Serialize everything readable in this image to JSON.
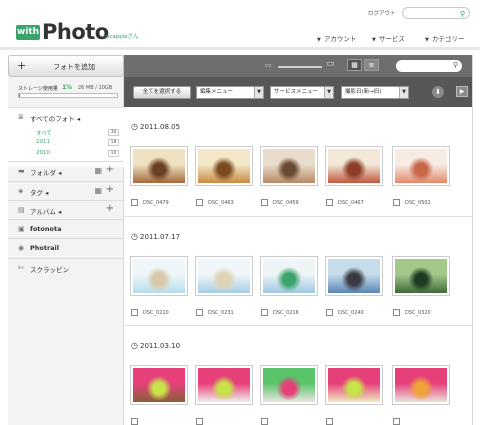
{
  "header": {
    "login": "ログアウト",
    "logo_badge": "with",
    "logo_word": "Photo",
    "greeting": "cocappleさん",
    "nav": [
      "アカウント",
      "サービス",
      "カテゴリー"
    ],
    "nav_arrow": "▼",
    "search_icon": "⚲"
  },
  "sidebar": {
    "add_photo": {
      "plus": "+",
      "label": "フォトを追加"
    },
    "storage": {
      "label": "ストレージ使用量",
      "percent": "1%",
      "value": "26 MB / 10GB",
      "fill_fraction": 0.01
    },
    "sections": [
      {
        "title": "すべてのフォト ◂",
        "icon": "≣"
      },
      {
        "title": "フォルダ ◂",
        "icon": "▬",
        "grid": "▦",
        "plus": "+"
      },
      {
        "title": "タグ ◂",
        "icon": "◈",
        "grid": "▦",
        "plus": "+"
      },
      {
        "title": "アルバム ◂",
        "icon": "▤",
        "plus": "+"
      },
      {
        "title": "fotonota",
        "icon": "▣"
      },
      {
        "title": "Photrail",
        "icon": "◉"
      },
      {
        "title": "スクラッピン",
        "icon": "✄"
      }
    ],
    "all_items": [
      {
        "label": "すべて",
        "count": "30"
      },
      {
        "label": "2011",
        "count": "18"
      },
      {
        "label": "2010",
        "count": "10"
      }
    ]
  },
  "toolbar": {
    "zoom_small_icon": "▭",
    "zoom_large_icon": "▭",
    "view_grid_icon": "▦",
    "view_list_icon": "≡",
    "search_icon": "⚲"
  },
  "filterbar": {
    "select_all": "全てを選択する",
    "edit_menu": "編集メニュー",
    "service_menu": "サービスメニュー",
    "sort": "撮影日(新→旧)",
    "caret": "▼",
    "download_icon": "⬇",
    "slideshow_icon": "▶"
  },
  "groups": [
    {
      "date": "2011.08.05",
      "photos": [
        {
          "name": "DSC_0479",
          "colors": [
            "#a46a3c",
            "#f0e2c0",
            "#6a3e22"
          ]
        },
        {
          "name": "DSC_0463",
          "colors": [
            "#c98a42",
            "#f4e8c8",
            "#7a4a20"
          ]
        },
        {
          "name": "DSC_0459",
          "colors": [
            "#b88a66",
            "#e8dccc",
            "#6a4a34"
          ]
        },
        {
          "name": "DSC_0467",
          "colors": [
            "#c2583e",
            "#f2e8d8",
            "#8a3e28"
          ]
        },
        {
          "name": "DSC_0501",
          "colors": [
            "#e28a6a",
            "#f6ece4",
            "#c8664a"
          ]
        }
      ]
    },
    {
      "date": "2011.07.17",
      "photos": [
        {
          "name": "DSC_0210",
          "colors": [
            "#b8dcea",
            "#eef6f8",
            "#d8c8a8"
          ]
        },
        {
          "name": "DSC_0231",
          "colors": [
            "#a6cfe4",
            "#f0f6f8",
            "#e0d2b4"
          ]
        },
        {
          "name": "DSC_0216",
          "colors": [
            "#9ec8e2",
            "#eef4f6",
            "#3aa46c"
          ]
        },
        {
          "name": "DSC_0240",
          "colors": [
            "#5a86b4",
            "#c6dcea",
            "#3a3a44"
          ]
        },
        {
          "name": "DSC_0320",
          "colors": [
            "#3e6a3a",
            "#a4c88a",
            "#1e3a22"
          ]
        }
      ]
    },
    {
      "date": "2011.03.10",
      "photos": [
        {
          "name": "",
          "colors": [
            "#8a5e3a",
            "#e6407a",
            "#c8e24a"
          ]
        },
        {
          "name": "",
          "colors": [
            "#f0eeea",
            "#e6407a",
            "#c8e24a"
          ]
        },
        {
          "name": "",
          "colors": [
            "#e8e6e0",
            "#5ac46a",
            "#e6407a"
          ]
        },
        {
          "name": "",
          "colors": [
            "#f0e8c0",
            "#e6407a",
            "#c8e24a"
          ]
        },
        {
          "name": "",
          "colors": [
            "#e8e2d8",
            "#e6407a",
            "#f0a23a"
          ]
        }
      ]
    }
  ]
}
